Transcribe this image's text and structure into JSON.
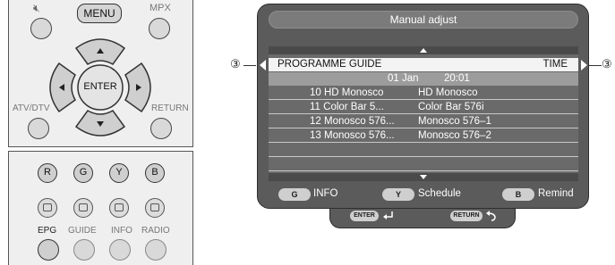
{
  "remote": {
    "mute_label": "",
    "menu_label": "MENU",
    "mpx_label": "MPX",
    "enter_label": "ENTER",
    "atv_dtv_label": "ATV/DTV",
    "return_label": "RETURN",
    "color_buttons": [
      "R",
      "G",
      "Y",
      "B"
    ],
    "bottom_labels": [
      "EPG",
      "GUIDE",
      "INFO",
      "RADIO"
    ]
  },
  "screen": {
    "title": "Manual adjust",
    "header_left": "PROGRAMME GUIDE",
    "header_right": "TIME",
    "date": "01 Jan",
    "time": "20:01",
    "rows": [
      {
        "channel": "10 HD Monosco",
        "programme": "HD Monosco"
      },
      {
        "channel": "11 Color Bar 5...",
        "programme": "Color Bar 576i"
      },
      {
        "channel": "12 Monosco 576...",
        "programme": "Monosco 576–1"
      },
      {
        "channel": "13 Monosco 576...",
        "programme": "Monosco 576–2"
      }
    ],
    "legend": [
      {
        "key": "G",
        "label": "INFO"
      },
      {
        "key": "Y",
        "label": "Schedule"
      },
      {
        "key": "B",
        "label": "Remind"
      }
    ],
    "nav_enter": "ENTER",
    "nav_return": "RETURN"
  },
  "callouts": {
    "left": "③",
    "right": "③"
  }
}
